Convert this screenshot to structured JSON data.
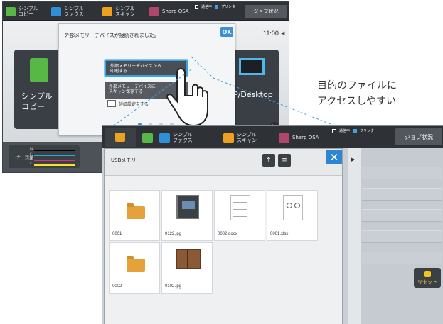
{
  "back_screen": {
    "tabs": [
      {
        "label": "シンプル\nコピー",
        "color": "#57b845"
      },
      {
        "label": "シンプル\nファクス",
        "color": "#2f8fd8"
      },
      {
        "label": "シンプル\nスキャン",
        "color": "#f0a020"
      },
      {
        "label": "Sharp OSA",
        "color": "#b0476a"
      }
    ],
    "status": {
      "job": "通信中",
      "printer": "プリンター"
    },
    "job_button": "ジョブ状況",
    "clock": "11:00",
    "dialog": {
      "message": "外部メモリーデバイスが接続されました。",
      "ok": "OK",
      "print_button": "外部メモリーデバイスから\n印刷する",
      "scan_button": "外部メモリーデバイスに\nスキャン保存する",
      "detail_checkbox": "詳細設定をする"
    },
    "left_tile_label": "シンプル\nコピー",
    "right_tile_label": "P/Desktop",
    "toner": {
      "label": "トナー残量",
      "colors": [
        "Bk",
        "C",
        "M",
        "Y"
      ]
    }
  },
  "caption": {
    "line1": "目的のファイルに",
    "line2": "アクセスしやすい"
  },
  "front_screen": {
    "tabs": [
      {
        "label": "シンプル\nファクス",
        "color": "#2f8fd8"
      },
      {
        "label": "シンプル\nスキャン",
        "color": "#f0a020"
      },
      {
        "label": "Sharp OSA",
        "color": "#b0476a"
      }
    ],
    "status": {
      "job": "通信中",
      "printer": "プリンター"
    },
    "job_button": "ジョブ状況",
    "panel_title": "USBメモリー",
    "files": [
      {
        "name": "0001",
        "kind": "folder"
      },
      {
        "name": "0122.jpg",
        "kind": "image"
      },
      {
        "name": "0002.docx",
        "kind": "doc"
      },
      {
        "name": "0001.xlsx",
        "kind": "xls"
      },
      {
        "name": "0002",
        "kind": "folder"
      },
      {
        "name": "0102.jpg",
        "kind": "book"
      }
    ],
    "reset_label": "リセット"
  }
}
